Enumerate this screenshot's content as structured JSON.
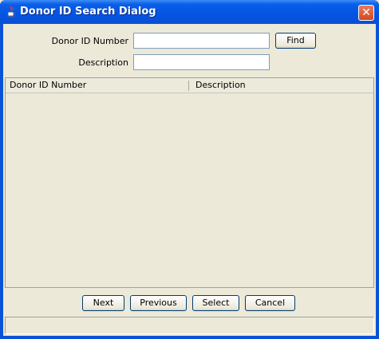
{
  "window": {
    "title": "Donor ID Search Dialog",
    "close_label": "✕"
  },
  "form": {
    "donor_id_label": "Donor ID Number",
    "donor_id_value": "",
    "description_label": "Description",
    "description_value": "",
    "find_label": "Find"
  },
  "table": {
    "columns": [
      "Donor ID Number",
      "Description"
    ],
    "rows": []
  },
  "footer": {
    "next_label": "Next",
    "previous_label": "Previous",
    "select_label": "Select",
    "cancel_label": "Cancel"
  },
  "status": {
    "text": ""
  },
  "icons": {
    "app": "java-cup-icon",
    "close": "close-icon"
  }
}
